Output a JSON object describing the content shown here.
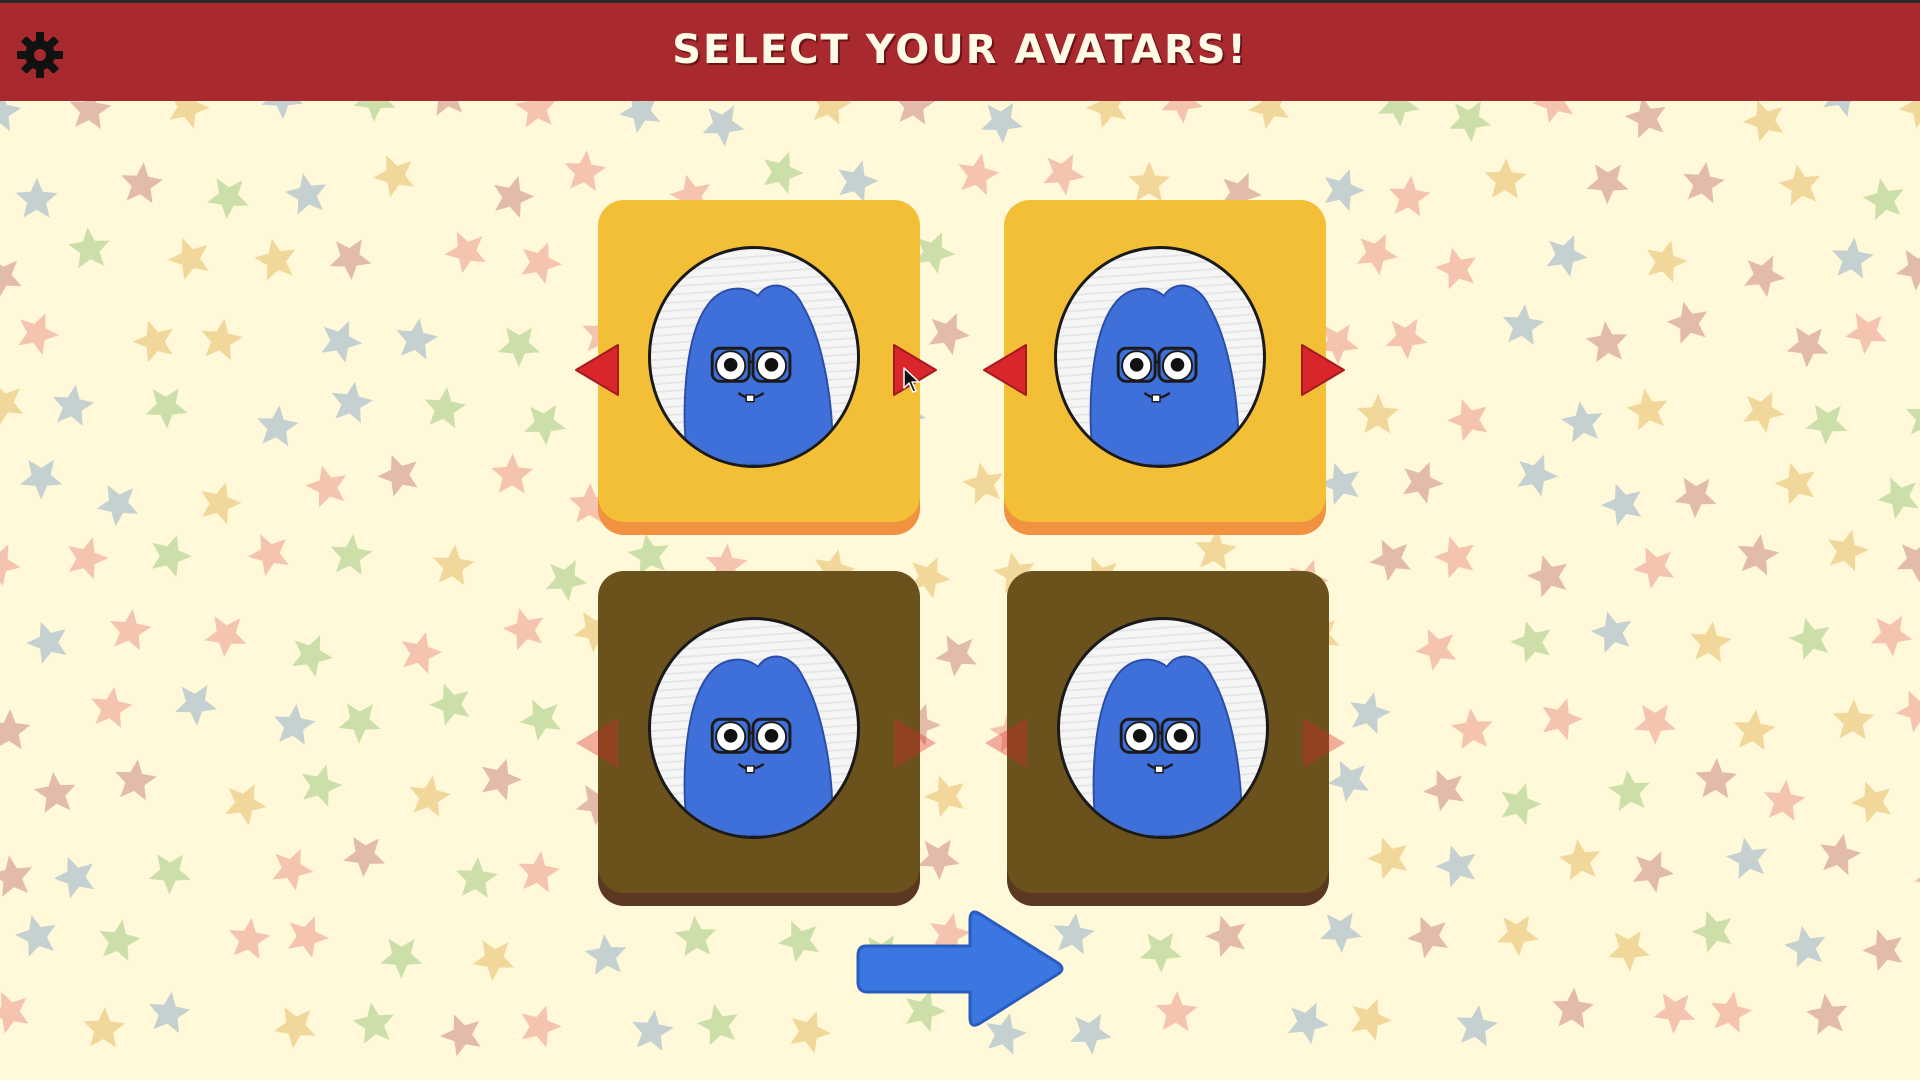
{
  "header": {
    "title": "SELECT YOUR AVATARS!",
    "settings_icon": "gear-icon",
    "background_color": "#a8292e"
  },
  "background": {
    "color": "#fff8d9",
    "pattern": "star-icon",
    "star_colors": [
      "#e8857a",
      "#7fa0c8",
      "#8fc06e",
      "#e3b050",
      "#c07070"
    ]
  },
  "avatar_slots": [
    {
      "state": "selected",
      "avatar": "blue-blob-glasses",
      "prev_icon": "triangle-left-icon",
      "next_icon": "triangle-right-icon"
    },
    {
      "state": "selected",
      "avatar": "blue-blob-glasses",
      "prev_icon": "triangle-left-icon",
      "next_icon": "triangle-right-icon"
    },
    {
      "state": "inactive",
      "avatar": "blue-blob-glasses",
      "prev_icon": "triangle-left-icon",
      "next_icon": "triangle-right-icon"
    },
    {
      "state": "inactive",
      "avatar": "blue-blob-glasses",
      "prev_icon": "triangle-left-icon",
      "next_icon": "triangle-right-icon"
    }
  ],
  "colors": {
    "card_active": "#f2bf36",
    "card_inactive": "#6b521c",
    "arrow_red": "#d9262b",
    "avatar_blue": "#3f6fd8",
    "next_arrow": "#3a77e0"
  },
  "next_button": {
    "icon": "arrow-right-icon"
  }
}
